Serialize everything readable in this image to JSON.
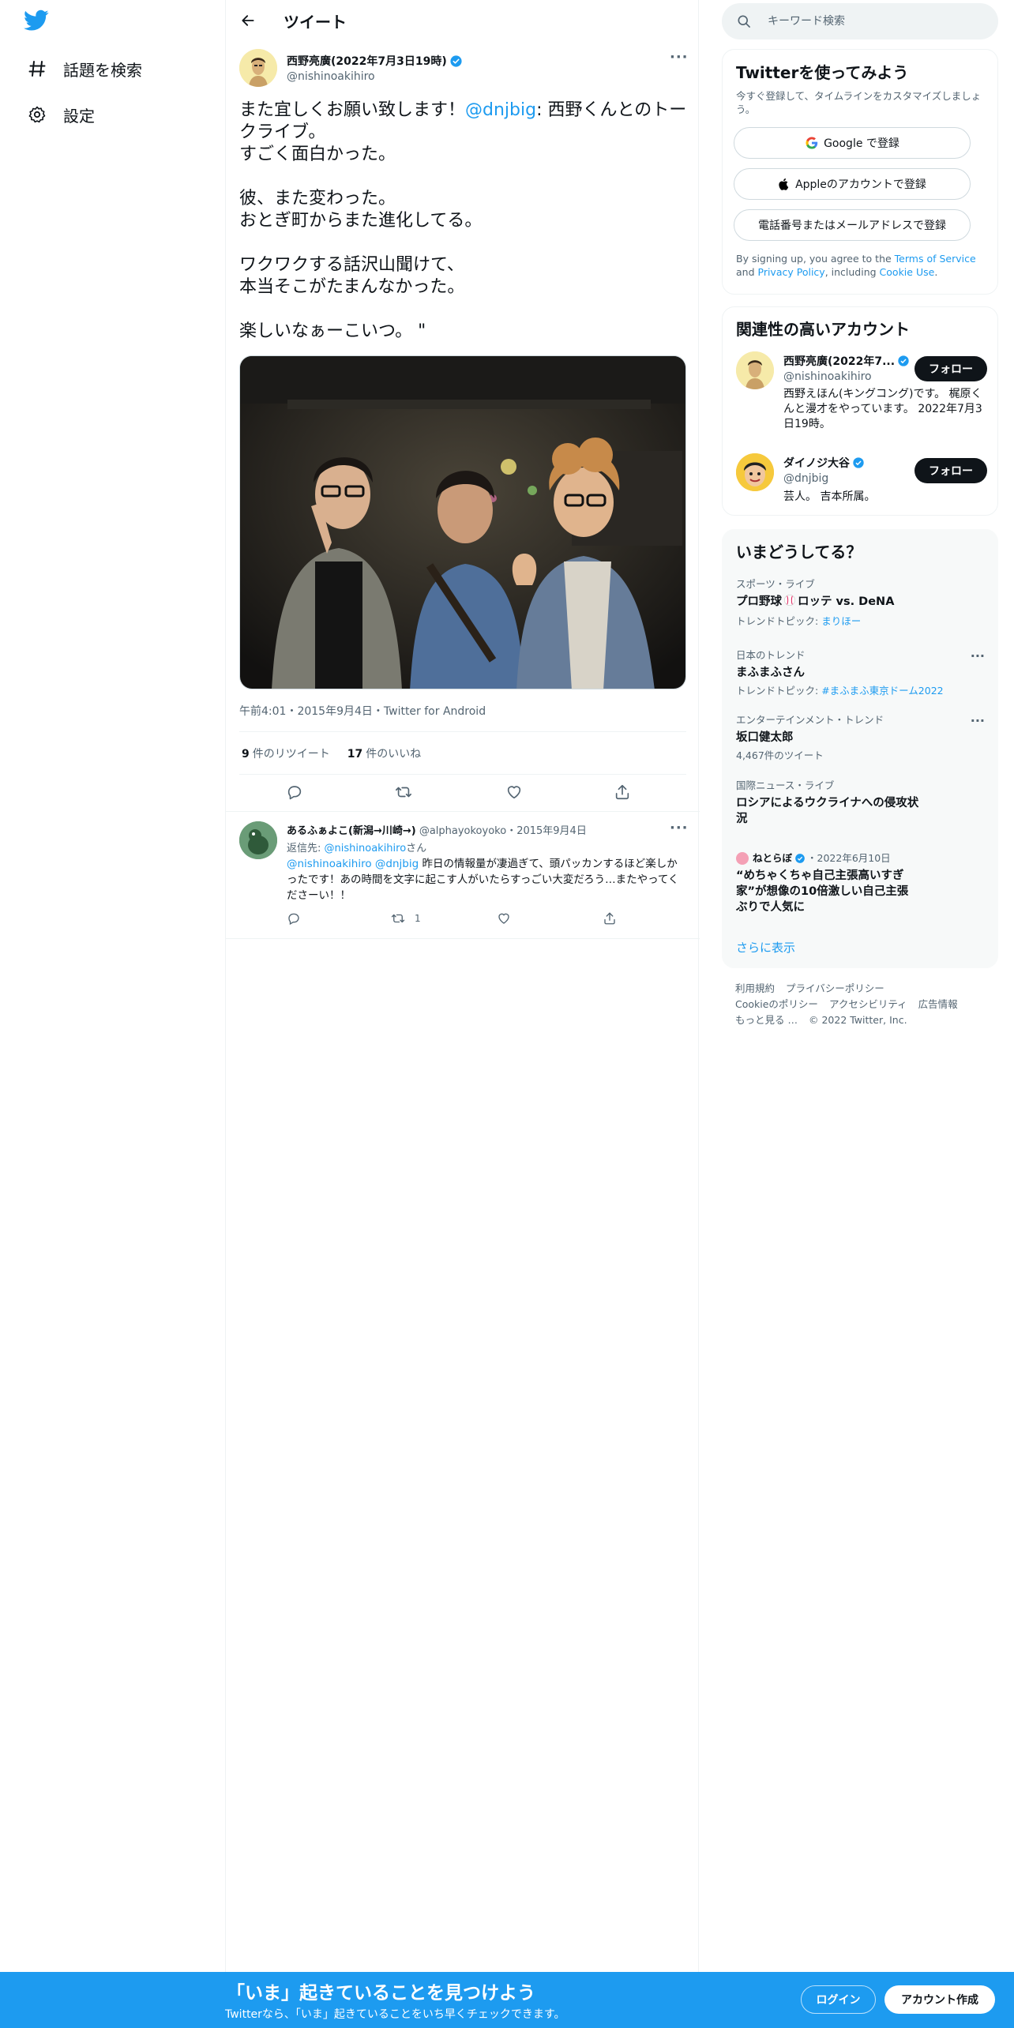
{
  "colors": {
    "accent": "#1d9bf0",
    "text": "#0f1419",
    "muted": "#536471",
    "border": "#eff3f4",
    "bottom_bar": "#1d9bf0"
  },
  "left_nav": {
    "logo_icon": "twitter-bird-icon",
    "items": [
      {
        "icon": "hashtag-icon",
        "label": "話題を検索"
      },
      {
        "icon": "gear-icon",
        "label": "設定"
      }
    ]
  },
  "header": {
    "title": "ツイート",
    "back_icon": "arrow-left-icon"
  },
  "tweet": {
    "author_name": "西野亮廣(2022年7月3日19時)",
    "author_handle": "@nishinoakihiro",
    "verified_icon": "verified-badge-icon",
    "text_before_mention": "また宜しくお願い致します！",
    "mention": "@dnjbig",
    "text_after_mention": ": 西野くんとのトークライブ。\nすごく面白かった。\n\n彼、また変わった。\nおとぎ町からまた進化してる。\n\nワクワクする話沢山聞けて、\n本当そこがたまんなかった。\n\n楽しいなぁーこいつ。 \"",
    "meta": "午前4:01・2015年9月4日・Twitter for Android",
    "retweets_count": "9",
    "retweets_label": "件のリツイート",
    "likes_count": "17",
    "likes_label": "件のいいね",
    "actions": [
      "reply-icon",
      "retweet-icon",
      "like-icon",
      "share-icon"
    ]
  },
  "reply": {
    "author_name": "あるふぁよこ(新潟→川崎→)",
    "author_handle": "@alphayokoyoko",
    "date": "・2015年9月4日",
    "reply_to_label": "返信先:",
    "reply_to_handle": "@nishinoakihiro",
    "reply_to_suffix": "さん",
    "mention1": "@nishinoakihiro",
    "mention2": "@dnjbig",
    "text": " 昨日の情報量が凄過ぎて、頭パッカンするほど楽しかったです！あの時間を文字に起こす人がいたらすっごい大変だろう…またやってくださーい！！",
    "retweet_count": "1"
  },
  "search": {
    "placeholder": "キーワード検索"
  },
  "signup": {
    "title": "Twitterを使ってみよう",
    "subtitle": "今すぐ登録して、タイムラインをカスタマイズしましょう。",
    "google_label": "Google で登録",
    "apple_label": "Appleのアカウントで登録",
    "phone_label": "電話番号またはメールアドレスで登録",
    "terms_prefix": "By signing up, you agree to the ",
    "terms_link": "Terms of Service",
    "terms_and": " and ",
    "privacy_link": "Privacy Policy",
    "terms_including": ", including ",
    "cookie_link": "Cookie Use",
    "terms_end": "."
  },
  "relevant": {
    "title": "関連性の高いアカウント",
    "follow_label": "フォロー",
    "accounts": [
      {
        "name": "西野亮廣(2022年7...",
        "handle": "@nishinoakihiro",
        "bio": "西野えほん(キングコング)です。 梶原くんと漫才をやっています。 2022年7月3日19時。"
      },
      {
        "name": "ダイノジ大谷",
        "handle": "@dnjbig",
        "bio": "芸人。 吉本所属。"
      }
    ]
  },
  "trends": {
    "title": "いまどうしてる？",
    "items": [
      {
        "category": "スポーツ・ライブ",
        "name_before": "プロ野球",
        "name_after": "ロッテ vs. DeNA",
        "sub_prefix": "トレンドトピック: ",
        "sub_link": "まりほー"
      },
      {
        "category": "日本のトレンド",
        "name": "まふまふさん",
        "sub_prefix": "トレンドトピック: ",
        "sub_link": "#まふまふ東京ドーム2022"
      },
      {
        "category": "エンターテインメント・トレンド",
        "name": "坂口健太郎",
        "sub": "4,467件のツイート"
      },
      {
        "category": "国際ニュース・ライブ",
        "name": "ロシアによるウクライナへの侵攻状況"
      },
      {
        "source": "ねとらぼ",
        "date": "・2022年6月10日",
        "name": "“めちゃくちゃ自己主張高いすぎ家”が想像の10倍激しい自己主張ぶりで人気に"
      }
    ],
    "show_more": "さらに表示"
  },
  "footer": {
    "links": [
      "利用規約",
      "プライバシーポリシー",
      "Cookieのポリシー",
      "アクセシビリティ",
      "広告情報",
      "もっと見る …"
    ],
    "copyright": "© 2022 Twitter, Inc."
  },
  "bottom_bar": {
    "title": "「いま」起きていることを見つけよう",
    "subtitle": "Twitterなら、「いま」起きていることをいち早くチェックできます。",
    "login_label": "ログイン",
    "signup_label": "アカウント作成"
  }
}
